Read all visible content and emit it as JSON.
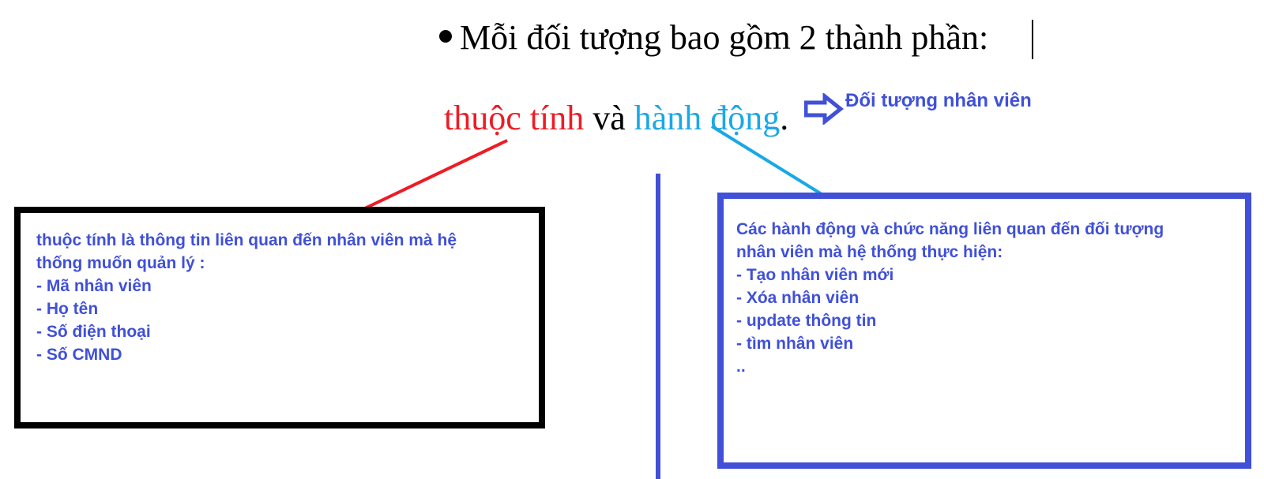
{
  "heading": {
    "bullet": "•",
    "text": "Mỗi đối tượng bao gồm 2 thành phần:"
  },
  "subline": {
    "attributes": "thuộc tính",
    "and": " và ",
    "actions": "hành động",
    "period": "."
  },
  "object_label": "Đối tượng nhân viên",
  "attributes_box": {
    "lines": [
      "thuộc tính là thông tin liên quan đến nhân viên mà hệ",
      "thống muốn quản lý :",
      "- Mã nhân viên",
      "- Họ tên",
      "- Số điện thoại",
      "- Số CMND"
    ]
  },
  "actions_box": {
    "lines": [
      "Các hành động và chức năng liên quan đến đối tượng",
      "nhân viên mà hệ thống thực hiện:",
      "- Tạo nhân viên mới",
      "- Xóa nhân viên",
      "- update thông tin",
      "- tìm nhân viên",
      ".."
    ]
  },
  "colors": {
    "attributes": "#ee1c24",
    "actions": "#1aa8e6",
    "label_blue": "#4050d8",
    "box_border_attr": "#000000",
    "box_border_action": "#4050d8"
  }
}
